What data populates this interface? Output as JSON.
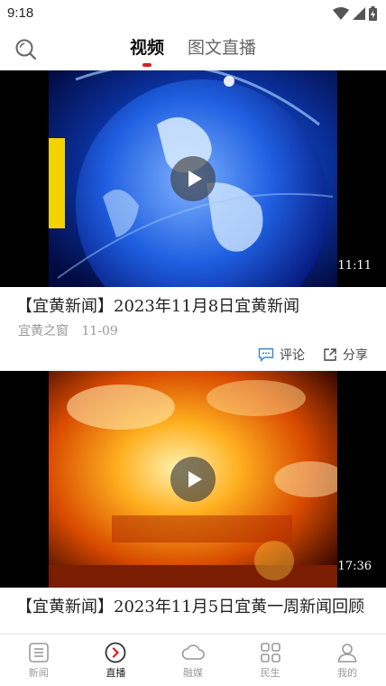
{
  "status_bar": {
    "time": "9:18",
    "icons": [
      "wifi-icon",
      "signal-icon",
      "battery-icon"
    ]
  },
  "top_nav": {
    "search_icon": "search-icon",
    "tabs": [
      {
        "label": "视频",
        "active": true
      },
      {
        "label": "图文直播",
        "active": false
      }
    ],
    "accent_color": "#d81e1e"
  },
  "feed": [
    {
      "title": "【宜黄新闻】2023年11月8日宜黄新闻",
      "source": "宜黄之窗",
      "date": "11-09",
      "duration": "11:11",
      "comment_label": "评论",
      "share_label": "分享"
    },
    {
      "title": "【宜黄新闻】2023年11月5日宜黄一周新闻回顾",
      "duration": "17:36"
    }
  ],
  "bottom_nav": [
    {
      "label": "新闻",
      "icon": "news-icon",
      "active": false
    },
    {
      "label": "直播",
      "icon": "live-icon",
      "active": true
    },
    {
      "label": "融媒",
      "icon": "cloud-icon",
      "active": false
    },
    {
      "label": "民生",
      "icon": "grid-icon",
      "active": false
    },
    {
      "label": "我的",
      "icon": "profile-icon",
      "active": false
    }
  ]
}
